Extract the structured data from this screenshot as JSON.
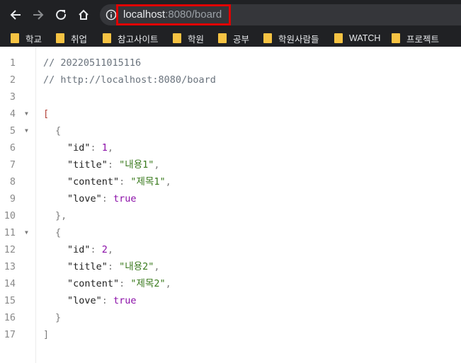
{
  "browser": {
    "url_host": "localhost",
    "url_rest": ":8080/board",
    "back_icon": "arrow-left",
    "forward_icon": "arrow-right",
    "reload_icon": "reload",
    "home_icon": "home",
    "info_icon": "info-circle"
  },
  "bookmarks": [
    {
      "label": "학교"
    },
    {
      "label": "취업"
    },
    {
      "label": "참고사이트"
    },
    {
      "label": "학원"
    },
    {
      "label": "공부"
    },
    {
      "label": "학원사람들"
    },
    {
      "label": "WATCH"
    },
    {
      "label": "프로젝트"
    }
  ],
  "code": {
    "comment1": "// 20220511015116",
    "comment2": "// http://localhost:8080/board",
    "open_array": "[",
    "close_array": "]",
    "open_obj": "{",
    "close_obj_comma": "},",
    "close_obj": "}",
    "items": [
      {
        "id_key": "\"id\"",
        "id_val": "1",
        "title_key": "\"title\"",
        "title_val": "\"내용1\"",
        "content_key": "\"content\"",
        "content_val": "\"제목1\"",
        "love_key": "\"love\"",
        "love_val": "true"
      },
      {
        "id_key": "\"id\"",
        "id_val": "2",
        "title_key": "\"title\"",
        "title_val": "\"내용2\"",
        "content_key": "\"content\"",
        "content_val": "\"제목2\"",
        "love_key": "\"love\"",
        "love_val": "true"
      }
    ],
    "line_numbers": [
      "1",
      "2",
      "3",
      "4",
      "5",
      "6",
      "7",
      "8",
      "9",
      "10",
      "11",
      "12",
      "13",
      "14",
      "15",
      "16",
      "17"
    ]
  },
  "colors": {
    "highlight_box": "#e00000",
    "toolbar_bg": "#202124",
    "string": "#3a7a1e",
    "number_bool": "#8b0fa8"
  }
}
